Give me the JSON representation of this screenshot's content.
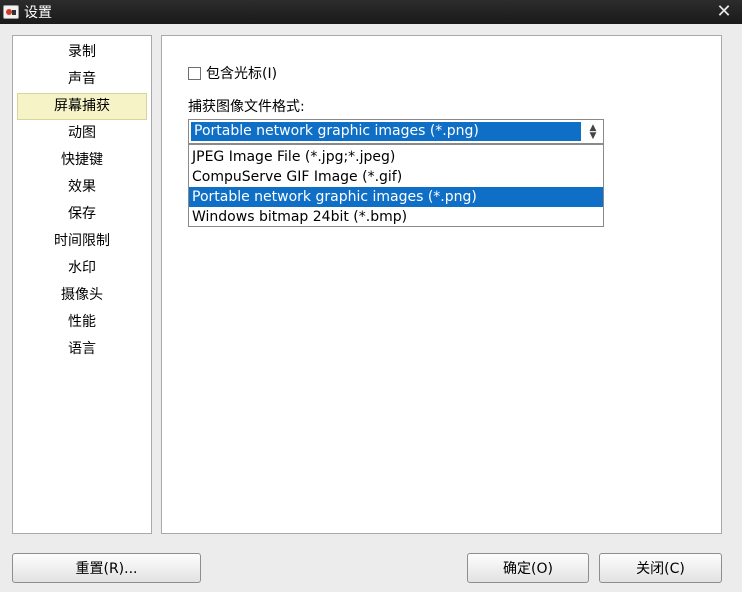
{
  "window": {
    "title": "设置",
    "close_glyph": "✕"
  },
  "sidebar": {
    "items": [
      {
        "label": "录制"
      },
      {
        "label": "声音"
      },
      {
        "label": "屏幕捕获",
        "active": true
      },
      {
        "label": "动图"
      },
      {
        "label": "快捷键"
      },
      {
        "label": "效果"
      },
      {
        "label": "保存"
      },
      {
        "label": "时间限制"
      },
      {
        "label": "水印"
      },
      {
        "label": "摄像头"
      },
      {
        "label": "性能"
      },
      {
        "label": "语言"
      }
    ]
  },
  "content": {
    "include_cursor": {
      "label": "包含光标(I)",
      "checked": false
    },
    "format_label": "捕获图像文件格式:",
    "format_select": {
      "value": "Portable network graphic images (*.png)",
      "options": [
        "JPEG Image File (*.jpg;*.jpeg)",
        "CompuServe GIF Image (*.gif)",
        "Portable network graphic images (*.png)",
        "Windows bitmap 24bit (*.bmp)"
      ],
      "highlighted_index": 2
    }
  },
  "footer": {
    "reset_label": "重置(R)...",
    "ok_label": "确定(O)",
    "close_label": "关闭(C)"
  },
  "colors": {
    "highlight": "#0f6fc6",
    "active_item_bg": "#f6f3c6",
    "titlebar": "#1f1f1f"
  }
}
